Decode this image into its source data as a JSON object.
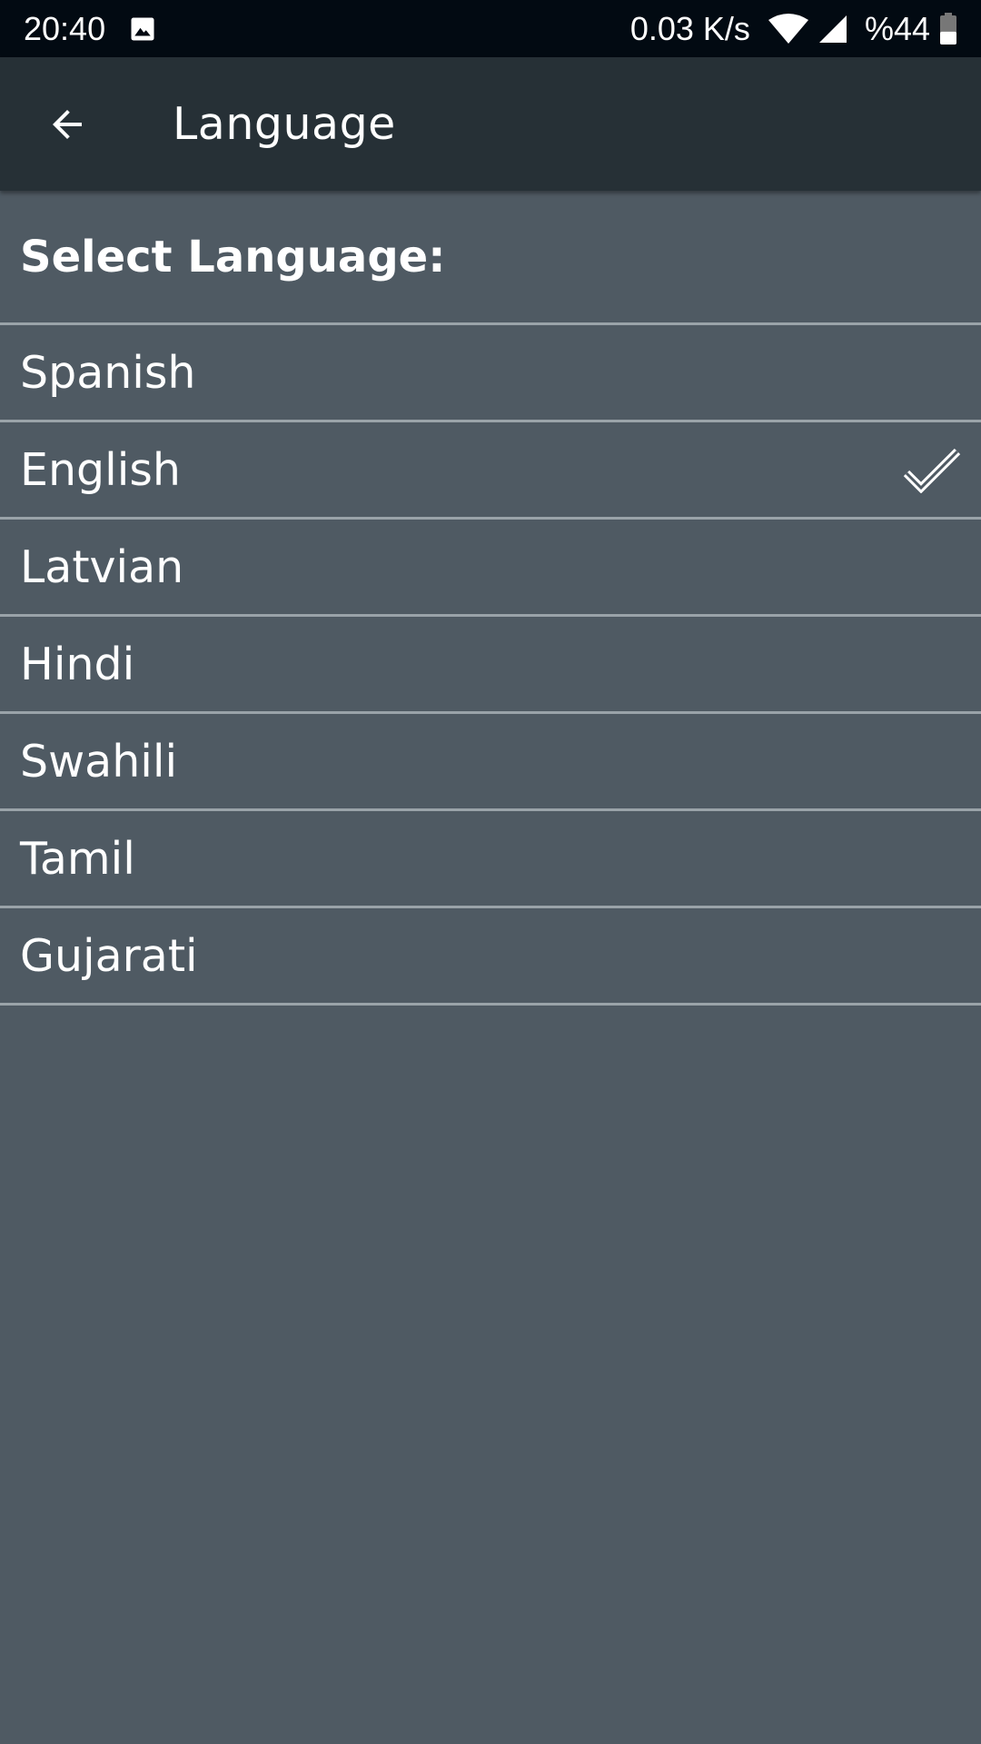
{
  "status_bar": {
    "time": "20:40",
    "image_icon": "image-icon",
    "net_speed": "0.03 K/s",
    "wifi_icon": "wifi-icon",
    "signal_icon": "cell-signal-icon",
    "battery_text": "%44",
    "battery_icon": "battery-icon",
    "battery_level": 0.44
  },
  "app_bar": {
    "back_icon": "arrow-back-icon",
    "title": "Language"
  },
  "section": {
    "header": "Select Language:"
  },
  "languages": [
    {
      "label": "Spanish",
      "selected": false
    },
    {
      "label": "English",
      "selected": true
    },
    {
      "label": "Latvian",
      "selected": false
    },
    {
      "label": "Hindi",
      "selected": false
    },
    {
      "label": "Swahili",
      "selected": false
    },
    {
      "label": "Tamil",
      "selected": false
    },
    {
      "label": "Gujarati",
      "selected": false
    }
  ],
  "colors": {
    "status_bar_bg": "#020a12",
    "app_bar_bg": "#263036",
    "page_bg": "#4f5a63",
    "divider": "#9aa3a9",
    "text": "#ffffff"
  }
}
